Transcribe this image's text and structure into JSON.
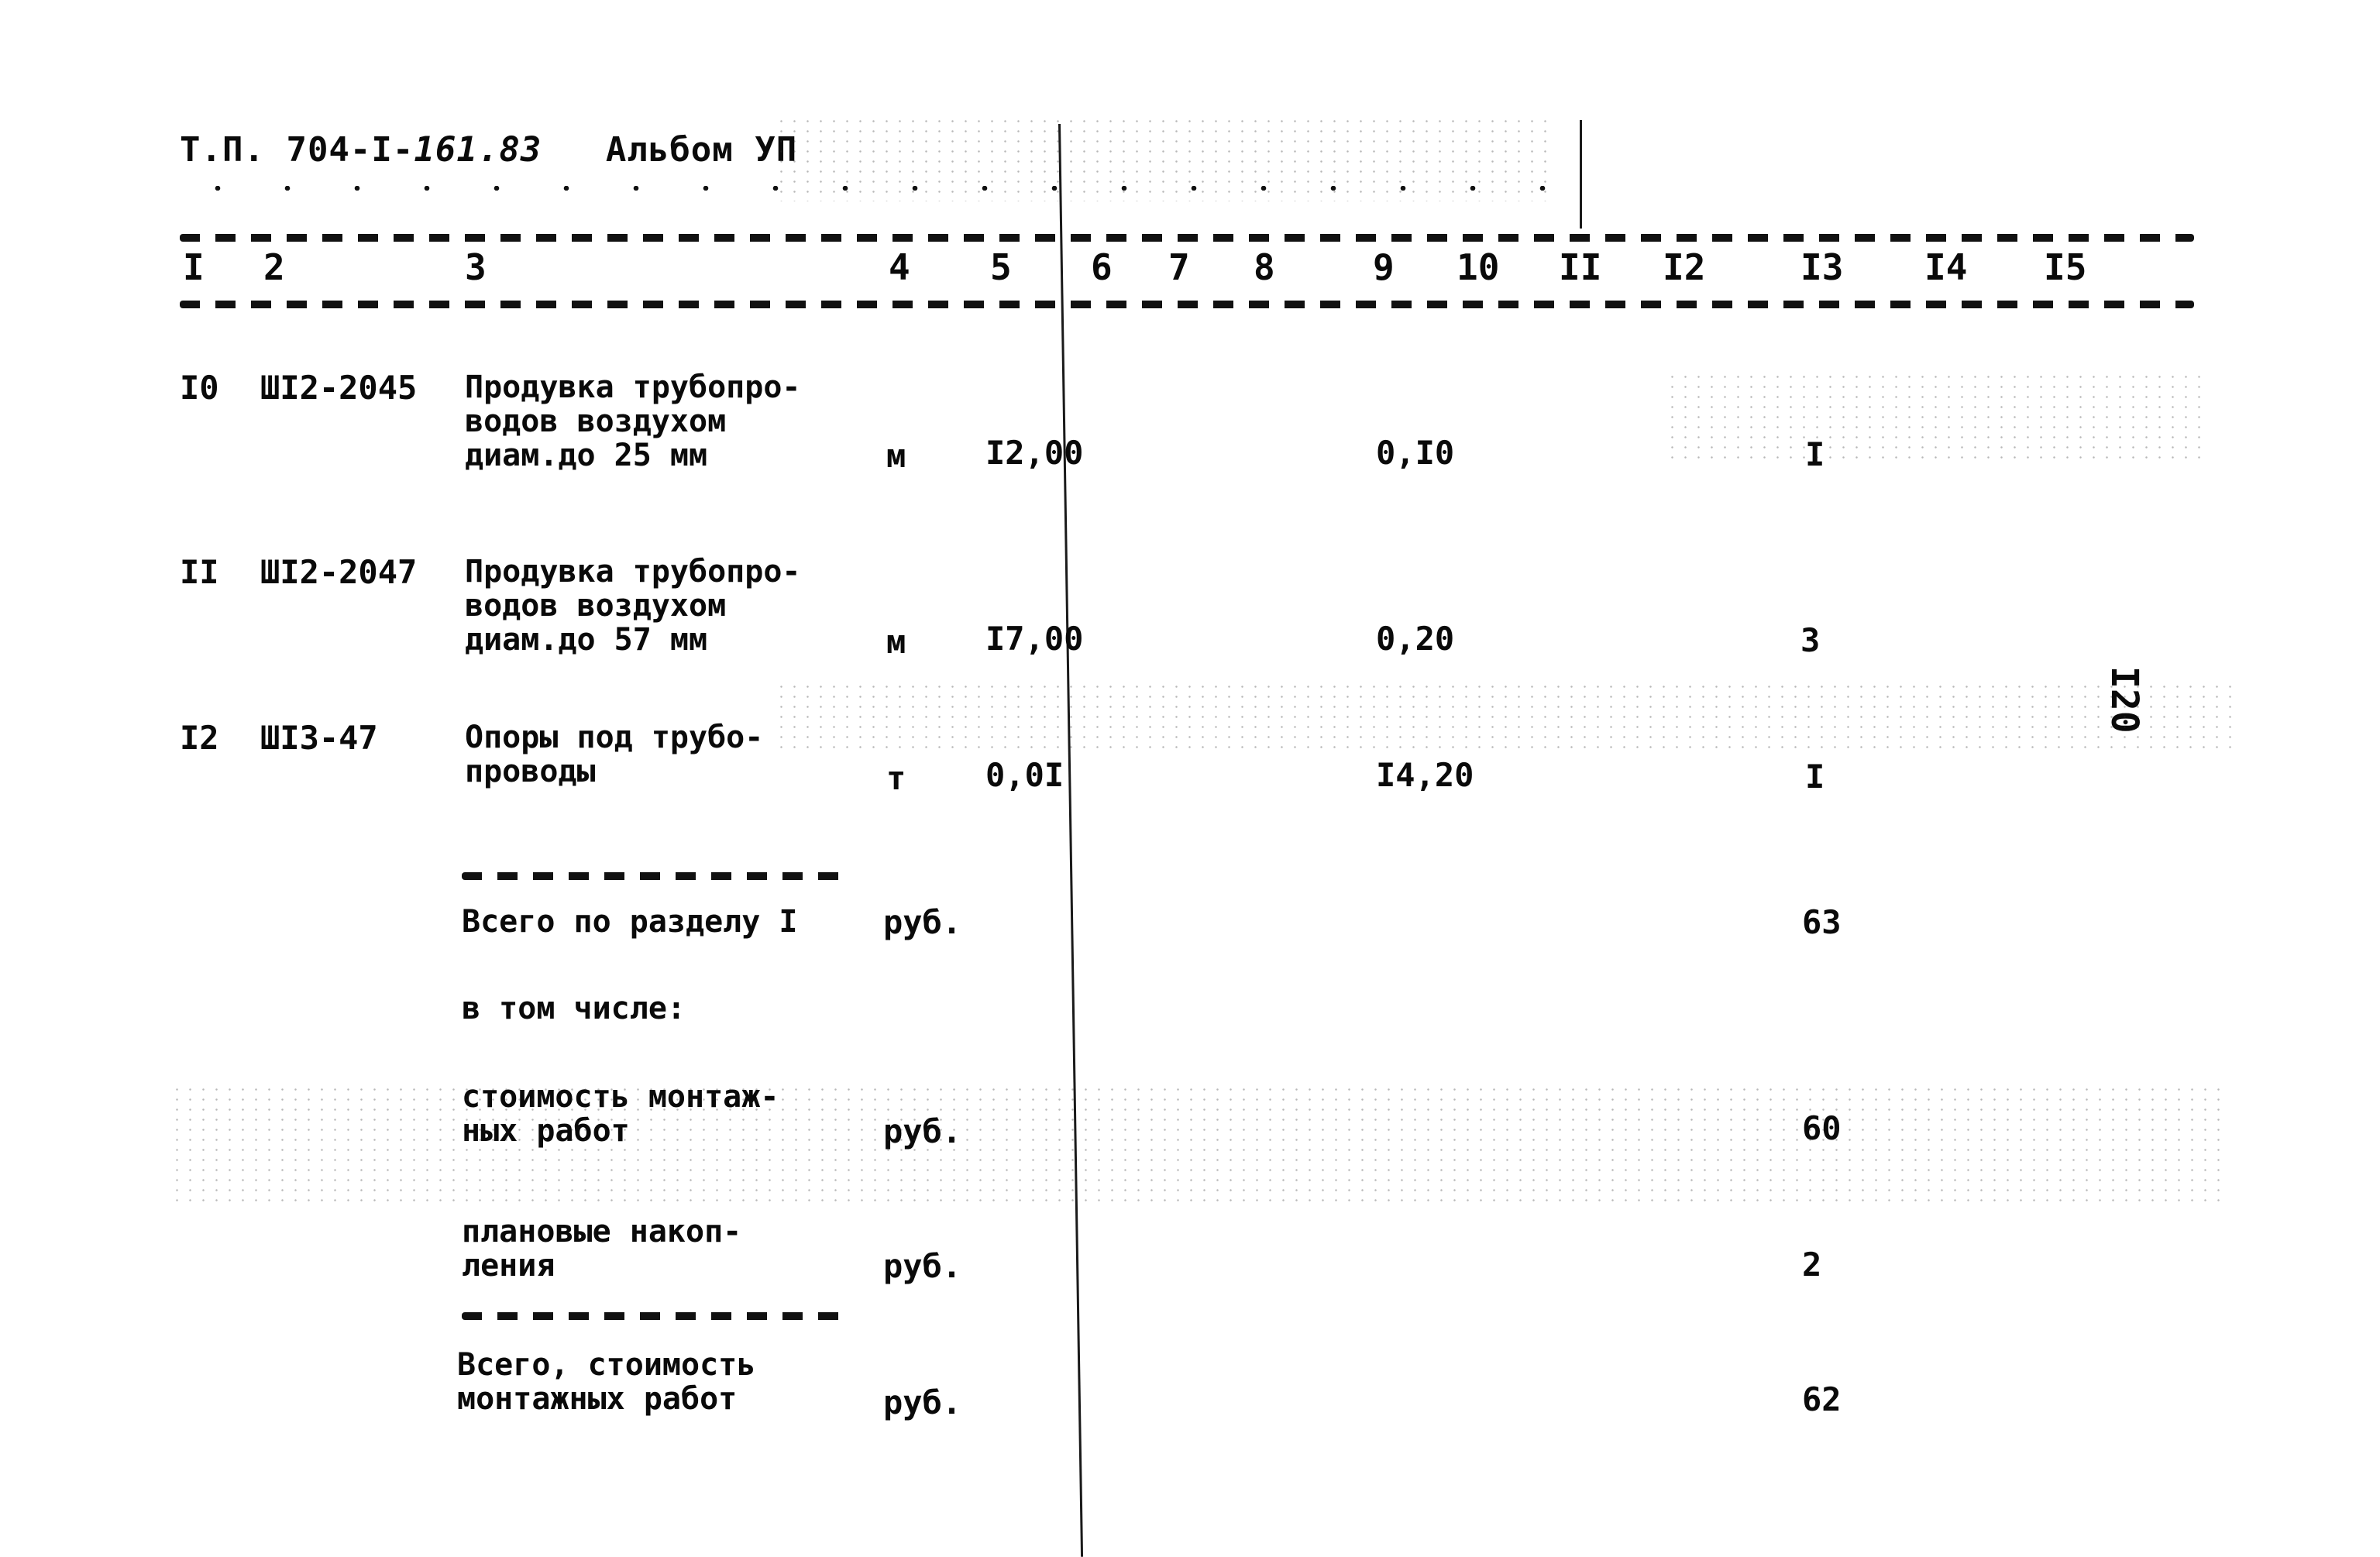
{
  "header": {
    "doc_code_prefix": "Т.П. 704-I-",
    "doc_code_handwritten": "161.83",
    "album": "Альбом УП"
  },
  "page_number": "I20",
  "columns": [
    "I",
    "2",
    "3",
    "4",
    "5",
    "6",
    "7",
    "8",
    "9",
    "10",
    "II",
    "I2",
    "I3",
    "I4",
    "I5"
  ],
  "rows": [
    {
      "num": "I0",
      "code": "ШI2-2045",
      "description": "Продувка трубопро-\nводов воздухом\nдиам.до 25 мм",
      "unit": "м",
      "quantity": "I2,00",
      "col9": "0,I0",
      "col13": "I"
    },
    {
      "num": "II",
      "code": "ШI2-2047",
      "description": "Продувка трубопро-\nводов воздухом\nдиам.до 57 мм",
      "unit": "м",
      "quantity": "I7,00",
      "col9": "0,20",
      "col13": "3"
    },
    {
      "num": "I2",
      "code": "ШI3-47",
      "description": "Опоры под трубо-\nпроводы",
      "unit": "т",
      "quantity": "0,0I",
      "col9": "I4,20",
      "col13": "I"
    }
  ],
  "summary": [
    {
      "label": "Всего по разделу I",
      "unit": "руб.",
      "value": "63"
    },
    {
      "label": "в том числе:",
      "unit": "",
      "value": ""
    },
    {
      "label": "стоимость монтаж-\nных работ",
      "unit": "руб.",
      "value": "60"
    },
    {
      "label": "плановые накоп-\nления",
      "unit": "руб.",
      "value": "2"
    },
    {
      "label": "Всего, стоимость\nмонтажных работ",
      "unit": "руб.",
      "value": "62"
    }
  ]
}
